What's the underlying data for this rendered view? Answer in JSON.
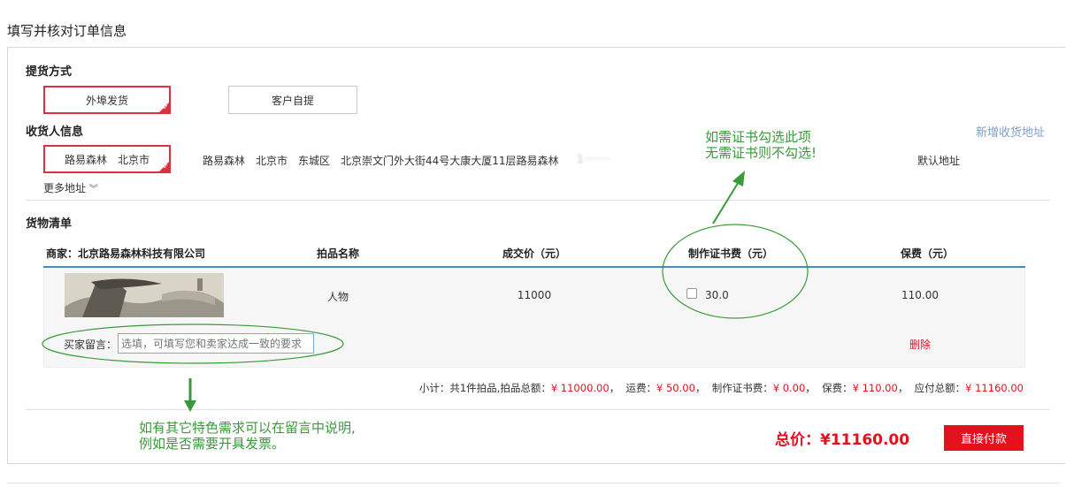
{
  "page_title": "填写并核对订单信息",
  "delivery": {
    "title": "提货方式",
    "options": [
      "外埠发货",
      "客户自提"
    ]
  },
  "receiver": {
    "title": "收货人信息",
    "add_link": "新增收货地址",
    "selected": "路易森林　北京市",
    "address": "路易森林　北京市　东城区　北京崇文门外大街44号大康大厦11层路易森林",
    "phone_masked": "1········",
    "default_label": "默认地址",
    "more_label": "更多地址"
  },
  "goods": {
    "title": "货物清单",
    "headers": [
      "商家：北京路易森林科技有限公司",
      "拍品名称",
      "成交价（元）",
      "制作证书费（元）",
      "保费（元）"
    ],
    "item": {
      "name": "人物",
      "price": "11000",
      "cert_fee": "30.0",
      "insurance": "110.00"
    },
    "message_label": "买家留言：",
    "message_placeholder": "选填，可填写您和卖家达成一致的要求",
    "delete_label": "删除"
  },
  "subtotal": {
    "prefix": "小计：共1件拍品,拍品总额：",
    "items_amount": "¥ 11000.00",
    "freight_label": "，  运费：",
    "freight": "¥ 50.00",
    "cert_label": "，  制作证书费：",
    "cert": "¥ 0.00",
    "insurance_label": "，  保费：",
    "insurance": "¥ 110.00",
    "total_label": "，  应付总额：",
    "total": "¥ 11160.00"
  },
  "total": {
    "label": "总价：",
    "amount": "¥11160.00",
    "pay_button": "直接付款"
  },
  "annotations": {
    "cert_note_1": "如需证书勾选此项",
    "cert_note_2": "无需证书则不勾选!",
    "message_note_1": "如有其它特色需求可以在留言中说明,",
    "message_note_2": "例如是否需要开具发票。"
  },
  "colors": {
    "accent_red": "#e5101d",
    "note_green": "#3a9a3a",
    "link_blue": "#7f9fc8",
    "table_line": "#4a8bc2"
  }
}
